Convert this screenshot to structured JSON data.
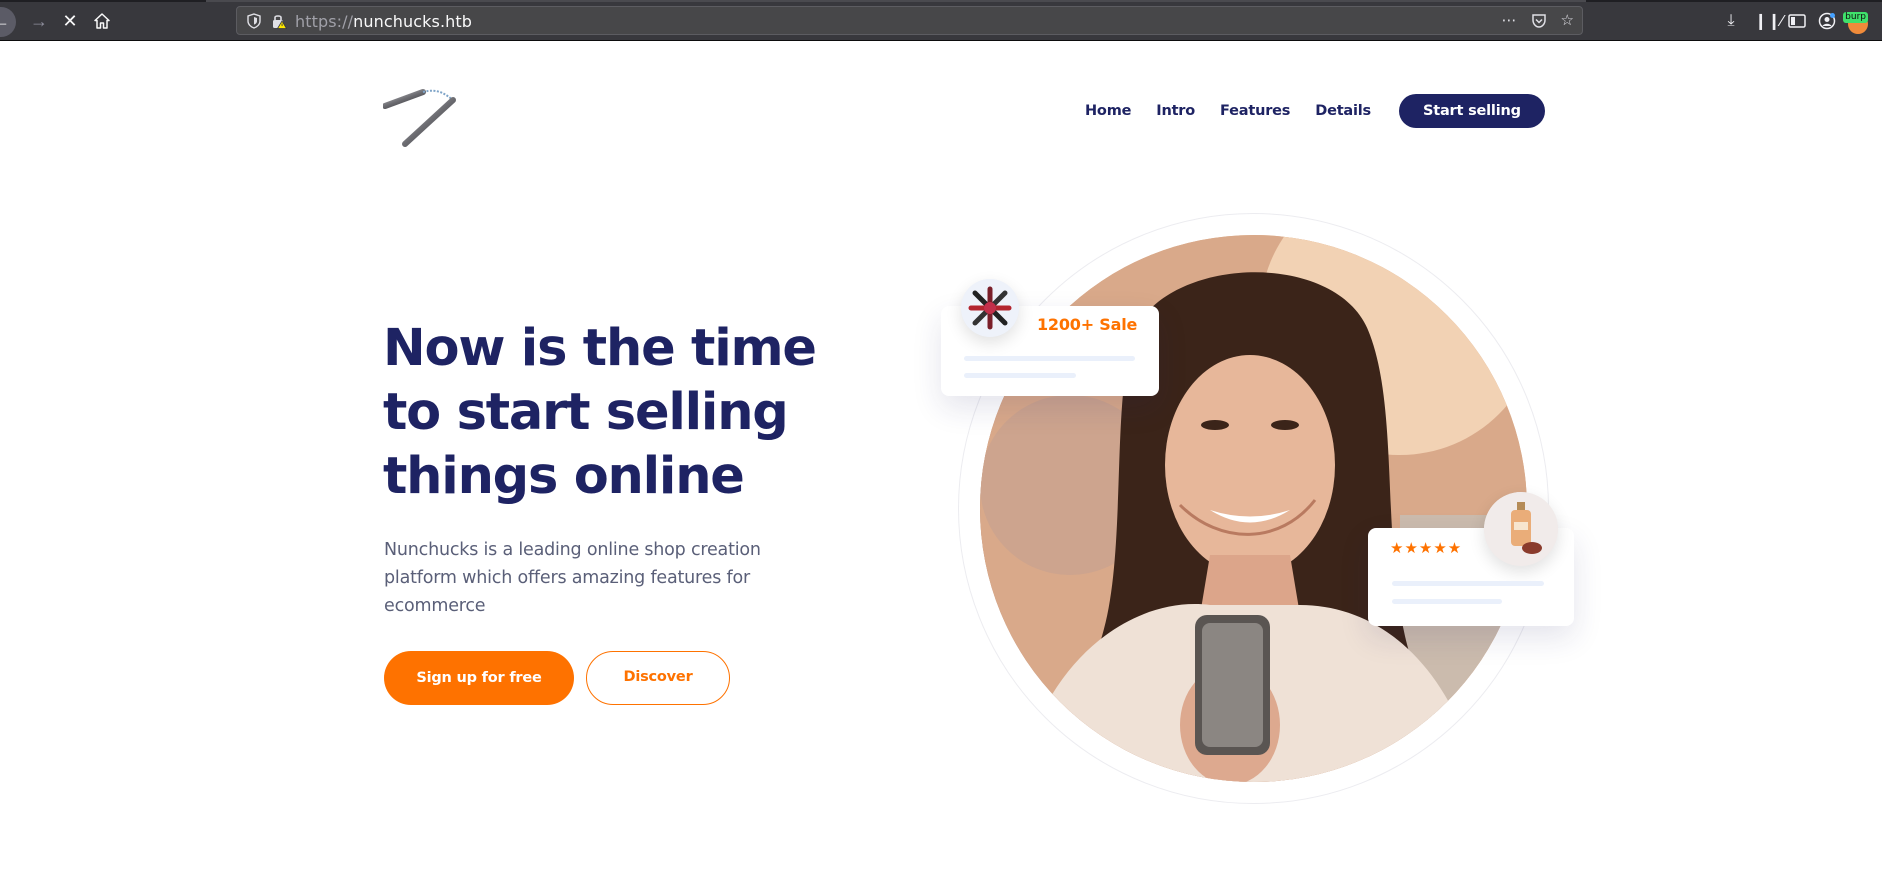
{
  "browser": {
    "url_scheme": "https://",
    "url_host": "nunchucks.htb",
    "url_actions": [
      "more-icon",
      "pocket-icon",
      "bookmark-star-icon"
    ],
    "toolbar_icons": [
      "download-icon",
      "library-icon",
      "sidebar-icon",
      "account-icon",
      "burp-extension-icon"
    ],
    "extension_badge": "burp"
  },
  "header": {
    "logo_alt": "nunchucks-logo",
    "nav": {
      "home": "Home",
      "intro": "Intro",
      "features": "Features",
      "details": "Details"
    },
    "cta": "Start selling"
  },
  "hero": {
    "title": "Now is the time to start selling things online",
    "description": "Nunchucks is a leading online shop creation platform which offers amazing features for ecommerce",
    "primary_button": "Sign up for free",
    "secondary_button": "Discover"
  },
  "cards": {
    "sale_text": "1200+ Sale",
    "rating_stars": "★★★★★"
  },
  "colors": {
    "navy": "#1e2363",
    "orange": "#fe7200",
    "chrome_bg": "#38383d"
  }
}
